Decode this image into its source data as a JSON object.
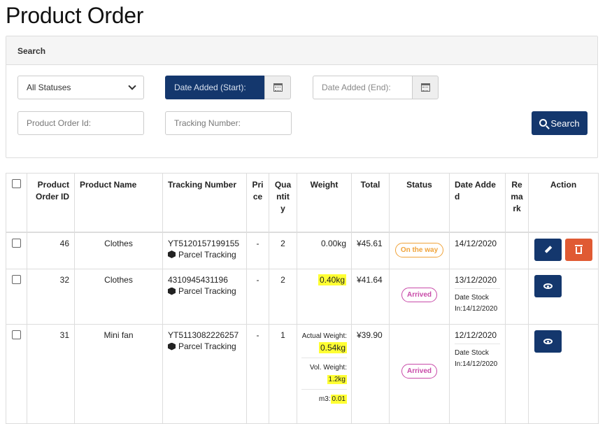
{
  "page": {
    "title": "Product Order"
  },
  "search": {
    "header": "Search",
    "status_value": "All Statuses",
    "date_start_placeholder": "Date Added (Start):",
    "date_end_placeholder": "Date Added (End):",
    "order_id_placeholder": "Product Order Id:",
    "tracking_placeholder": "Tracking Number:",
    "button_label": "Search"
  },
  "table": {
    "headers": [
      "Product Order ID",
      "Product Name",
      "Tracking Number",
      "Price",
      "Quantity",
      "Weight",
      "Total",
      "Status",
      "Date Added",
      "Remark",
      "Action"
    ],
    "parcel_tracking_label": "Parcel Tracking",
    "rows": [
      {
        "id": "46",
        "name": "Clothes",
        "tracking": "YT5120157199155",
        "price": "-",
        "qty": "2",
        "weight": "0.00kg",
        "total": "¥45.61",
        "status": "On the way",
        "date": "14/12/2020"
      },
      {
        "id": "32",
        "name": "Clothes",
        "tracking": "4310945431196",
        "price": "-",
        "qty": "2",
        "weight": "0.40kg",
        "total": "¥41.64",
        "status": "Arrived",
        "date": "13/12/2020",
        "date_stock_label": "Date Stock In:",
        "date_stock": "14/12/2020"
      },
      {
        "id": "31",
        "name": "Mini fan",
        "tracking": "YT5113082226257",
        "price": "-",
        "qty": "1",
        "actual_weight_label": "Actual Weight:",
        "weight": "0.54kg",
        "vol_weight_label": "Vol. Weight:",
        "vol_weight": "1.2kg",
        "m3_label": "m3:",
        "m3": "0.01",
        "total": "¥39.90",
        "status": "Arrived",
        "date": "12/12/2020",
        "date_stock_label": "Date Stock In:",
        "date_stock": "14/12/2020"
      }
    ]
  },
  "colors": {
    "primary": "#14376d",
    "danger": "#e05a33",
    "on_the_way": "#f0a33a",
    "arrived": "#c84aa8",
    "highlight": "#ffff33"
  }
}
